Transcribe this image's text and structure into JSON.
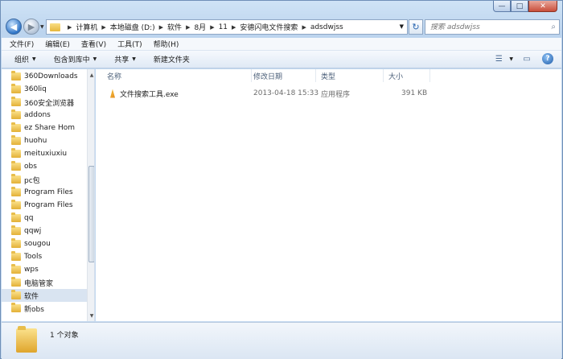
{
  "window": {
    "minimize_glyph": "—",
    "maximize_glyph": "□",
    "close_glyph": "✕"
  },
  "address": {
    "crumbs": [
      "计算机",
      "本地磁盘 (D:)",
      "软件",
      "8月",
      "11",
      "安德闪电文件搜索",
      "adsdwjss"
    ],
    "search_placeholder": "搜索 adsdwjss"
  },
  "menu": [
    "文件(F)",
    "编辑(E)",
    "查看(V)",
    "工具(T)",
    "帮助(H)"
  ],
  "commands": {
    "organize": "组织",
    "include_in_library": "包含到库中",
    "share": "共享",
    "new_folder": "新建文件夹"
  },
  "tree": [
    "360Downloads",
    "360liq",
    "360安全浏览器",
    "addons",
    "ez Share Hom",
    "huohu",
    "meituxiuxiu",
    "obs",
    "pc包",
    "Program Files",
    "Program Files",
    "qq",
    "qqwj",
    "sougou",
    "Tools",
    "wps",
    "电脑管家",
    "软件",
    "新obs"
  ],
  "tree_selected_index": 17,
  "columns": {
    "name": "名称",
    "modified": "修改日期",
    "type": "类型",
    "size": "大小"
  },
  "files": [
    {
      "name": "文件搜索工具.exe",
      "modified": "2013-04-18 15:33",
      "type": "应用程序",
      "size": "391 KB"
    }
  ],
  "status": {
    "count": "1 个对象"
  },
  "icons": {
    "back": "arrow-left-icon",
    "forward": "arrow-right-icon",
    "refresh": "refresh-icon",
    "search": "search-icon",
    "view": "view-options-icon",
    "preview": "preview-pane-icon",
    "help": "help-icon",
    "folder": "folder-icon",
    "exe": "exe-file-icon"
  }
}
